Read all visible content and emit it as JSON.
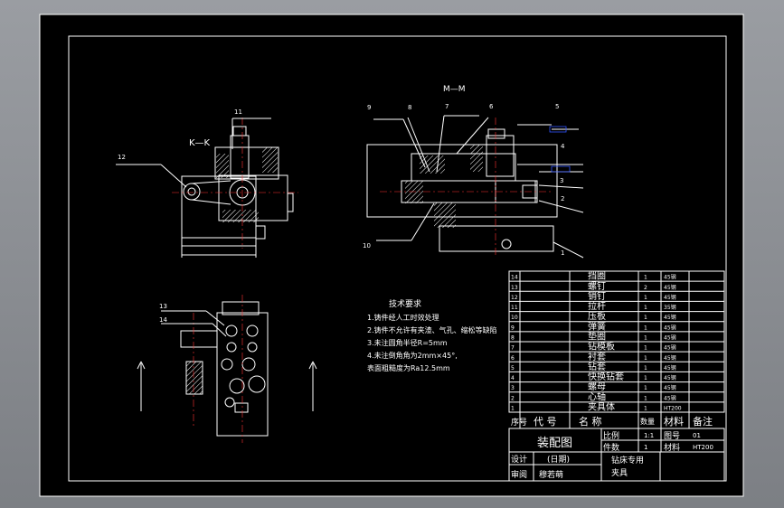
{
  "views": {
    "section_mm": "M—M",
    "section_kk": "K—K"
  },
  "balloons": {
    "left_top": [
      "11",
      "12"
    ],
    "left_bottom": [
      "13",
      "14"
    ],
    "main": [
      "1",
      "2",
      "3",
      "4",
      "5",
      "6",
      "7",
      "8",
      "9",
      "10"
    ]
  },
  "notes": {
    "title": "技术要求",
    "lines": [
      "1.铸件经人工时效处理",
      "2.铸件不允许有夹渣、气孔、缩松等缺陷",
      "3.未注圆角半径R=5mm",
      "4.未注倒角角为2mm×45°,",
      "  表面粗糙度为Ra12.5mm"
    ]
  },
  "bom": {
    "rows": [
      {
        "no": "14",
        "name": "挡圈",
        "qty": "1",
        "material": "45钢"
      },
      {
        "no": "13",
        "name": "螺钉",
        "qty": "2",
        "material": "45钢"
      },
      {
        "no": "12",
        "name": "销钉",
        "qty": "1",
        "material": "45钢"
      },
      {
        "no": "11",
        "name": "拉杆",
        "qty": "1",
        "material": "35钢"
      },
      {
        "no": "10",
        "name": "压板",
        "qty": "1",
        "material": "45钢"
      },
      {
        "no": "9",
        "name": "弹簧",
        "qty": "1",
        "material": "45钢"
      },
      {
        "no": "8",
        "name": "垫圈",
        "qty": "1",
        "material": "45钢"
      },
      {
        "no": "7",
        "name": "钻模板",
        "qty": "1",
        "material": "45钢"
      },
      {
        "no": "6",
        "name": "衬套",
        "qty": "1",
        "material": "45钢"
      },
      {
        "no": "5",
        "name": "钻套",
        "qty": "1",
        "material": "45钢"
      },
      {
        "no": "4",
        "name": "快换钻套",
        "qty": "1",
        "material": "45钢"
      },
      {
        "no": "3",
        "name": "螺母",
        "qty": "1",
        "material": "45钢"
      },
      {
        "no": "2",
        "name": "心轴",
        "qty": "1",
        "material": "45钢"
      },
      {
        "no": "1",
        "name": "夹具体",
        "qty": "1",
        "material": "HT200"
      }
    ],
    "header": {
      "no": "序号",
      "code": "代 号",
      "name": "名 称",
      "qty": "数量",
      "material": "材料",
      "note": "备注"
    }
  },
  "title_block": {
    "drawing_name": "装配图",
    "scale_label": "比例",
    "scale_value": "1:1",
    "count_label": "件数",
    "count_value": "1",
    "figure_label": "图号",
    "figure_value": "01",
    "material_label": "材料",
    "material_value": "HT200",
    "date_label": "(日期)",
    "designer_label": "设计",
    "reviewer_label": "审阅",
    "company": "钻床专用",
    "company_line2": "夹具",
    "reviewer_name": "穆若萌"
  },
  "colors": {
    "sheet": "#000000",
    "lines": "#ffffff",
    "leader_blue": "#3355ff",
    "center": "#ff3333",
    "frame_bg": "#8c8f94"
  }
}
